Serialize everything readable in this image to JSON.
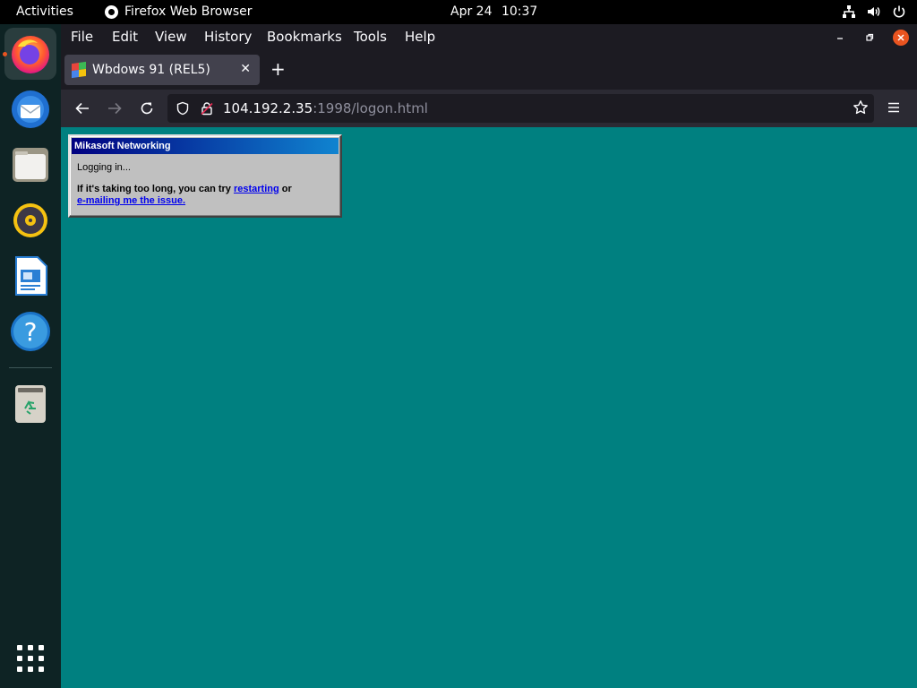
{
  "topbar": {
    "activities": "Activities",
    "app_name": "Firefox Web Browser",
    "date": "Apr 24",
    "time": "10:37"
  },
  "dock": {
    "items": [
      "firefox-icon",
      "thunderbird-icon",
      "files-icon",
      "rhythmbox-icon",
      "libreoffice-writer-icon",
      "help-icon",
      "trash-icon"
    ],
    "accent_color": "#e95420"
  },
  "browser": {
    "menu": [
      "File",
      "Edit",
      "View",
      "History",
      "Bookmarks",
      "Tools",
      "Help"
    ],
    "tab": {
      "title": "Wbdows 91 (REL5)"
    },
    "url": {
      "host": "104.192.2.35",
      "rest": ":1998/logon.html"
    }
  },
  "page": {
    "background": "#008080",
    "window": {
      "title": "Mikasoft Networking",
      "status": "Logging in...",
      "message_prefix": "If it's taking too long, you can try ",
      "link_restart": "restarting",
      "message_mid": " or",
      "link_email": "e-mailing me the issue."
    }
  }
}
